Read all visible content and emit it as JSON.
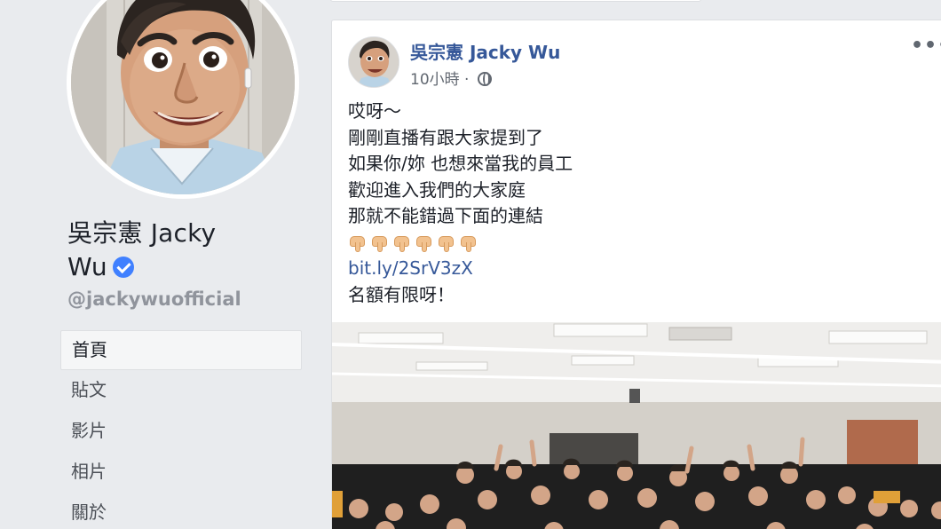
{
  "page": {
    "name": "吳宗憲 Jacky Wu",
    "name_line1": "吳宗憲 Jacky",
    "name_line2": "Wu",
    "handle": "@jackywuofficial",
    "verified": true
  },
  "nav": {
    "items": [
      {
        "label": "首頁",
        "active": true
      },
      {
        "label": "貼文",
        "active": false
      },
      {
        "label": "影片",
        "active": false
      },
      {
        "label": "相片",
        "active": false
      },
      {
        "label": "關於",
        "active": false
      }
    ]
  },
  "post": {
    "author": "吳宗憲 Jacky Wu",
    "time": "10小時",
    "separator": "·",
    "privacy_icon": "globe-icon",
    "more_label": "•••",
    "lines": [
      "哎呀～",
      "剛剛直播有跟大家提到了",
      "如果你/妳 也想來當我的員工",
      "歡迎進入我們的大家庭",
      "那就不能錯過下面的連結"
    ],
    "emoji": [
      "👇",
      "👇",
      "👇",
      "👇",
      "👇",
      "👇"
    ],
    "link": "bit.ly/2SrV3zX",
    "closing": "名額有限呀！",
    "photo_icon": "group-photo"
  },
  "colors": {
    "background": "#e9ebee",
    "link": "#365899",
    "verified": "#4080ff",
    "text": "#1d2129",
    "muted": "#90949c"
  }
}
